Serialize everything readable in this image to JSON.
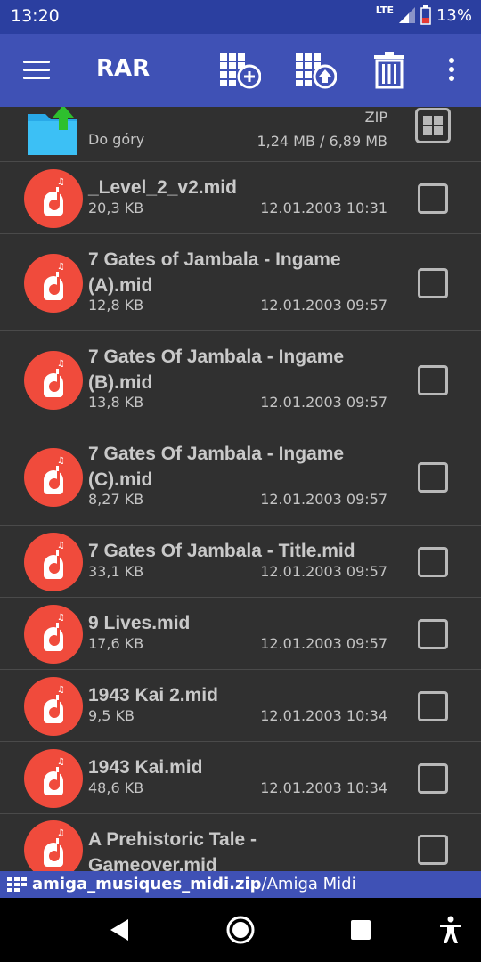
{
  "status_bar": {
    "time": "13:20",
    "network": "LTE",
    "battery": "13%"
  },
  "app_bar": {
    "title": "RAR"
  },
  "parent_entry": {
    "label": "Do góry",
    "type": "ZIP",
    "size": "1,24 MB / 6,89 MB"
  },
  "files": [
    {
      "name": "_Level_2_v2.mid",
      "size": "20,3 KB",
      "date": "12.01.2003 10:31"
    },
    {
      "name": "7 Gates of Jambala - Ingame (A).mid",
      "size": "12,8 KB",
      "date": "12.01.2003 09:57"
    },
    {
      "name": "7 Gates Of Jambala - Ingame (B).mid",
      "size": "13,8 KB",
      "date": "12.01.2003 09:57"
    },
    {
      "name": "7 Gates Of Jambala - Ingame (C).mid",
      "size": "8,27 KB",
      "date": "12.01.2003 09:57"
    },
    {
      "name": "7 Gates Of Jambala - Title.mid",
      "size": "33,1 KB",
      "date": "12.01.2003 09:57"
    },
    {
      "name": "9 Lives.mid",
      "size": "17,6 KB",
      "date": "12.01.2003 09:57"
    },
    {
      "name": "1943 Kai 2.mid",
      "size": "9,5 KB",
      "date": "12.01.2003 10:34"
    },
    {
      "name": "1943 Kai.mid",
      "size": "48,6 KB",
      "date": "12.01.2003 10:34"
    },
    {
      "name": "A Prehistoric Tale - Gameover.mid",
      "size": "",
      "date": ""
    }
  ],
  "path_bar": {
    "archive": "amiga_musiques_midi.zip",
    "folder": "/Amiga Midi"
  }
}
